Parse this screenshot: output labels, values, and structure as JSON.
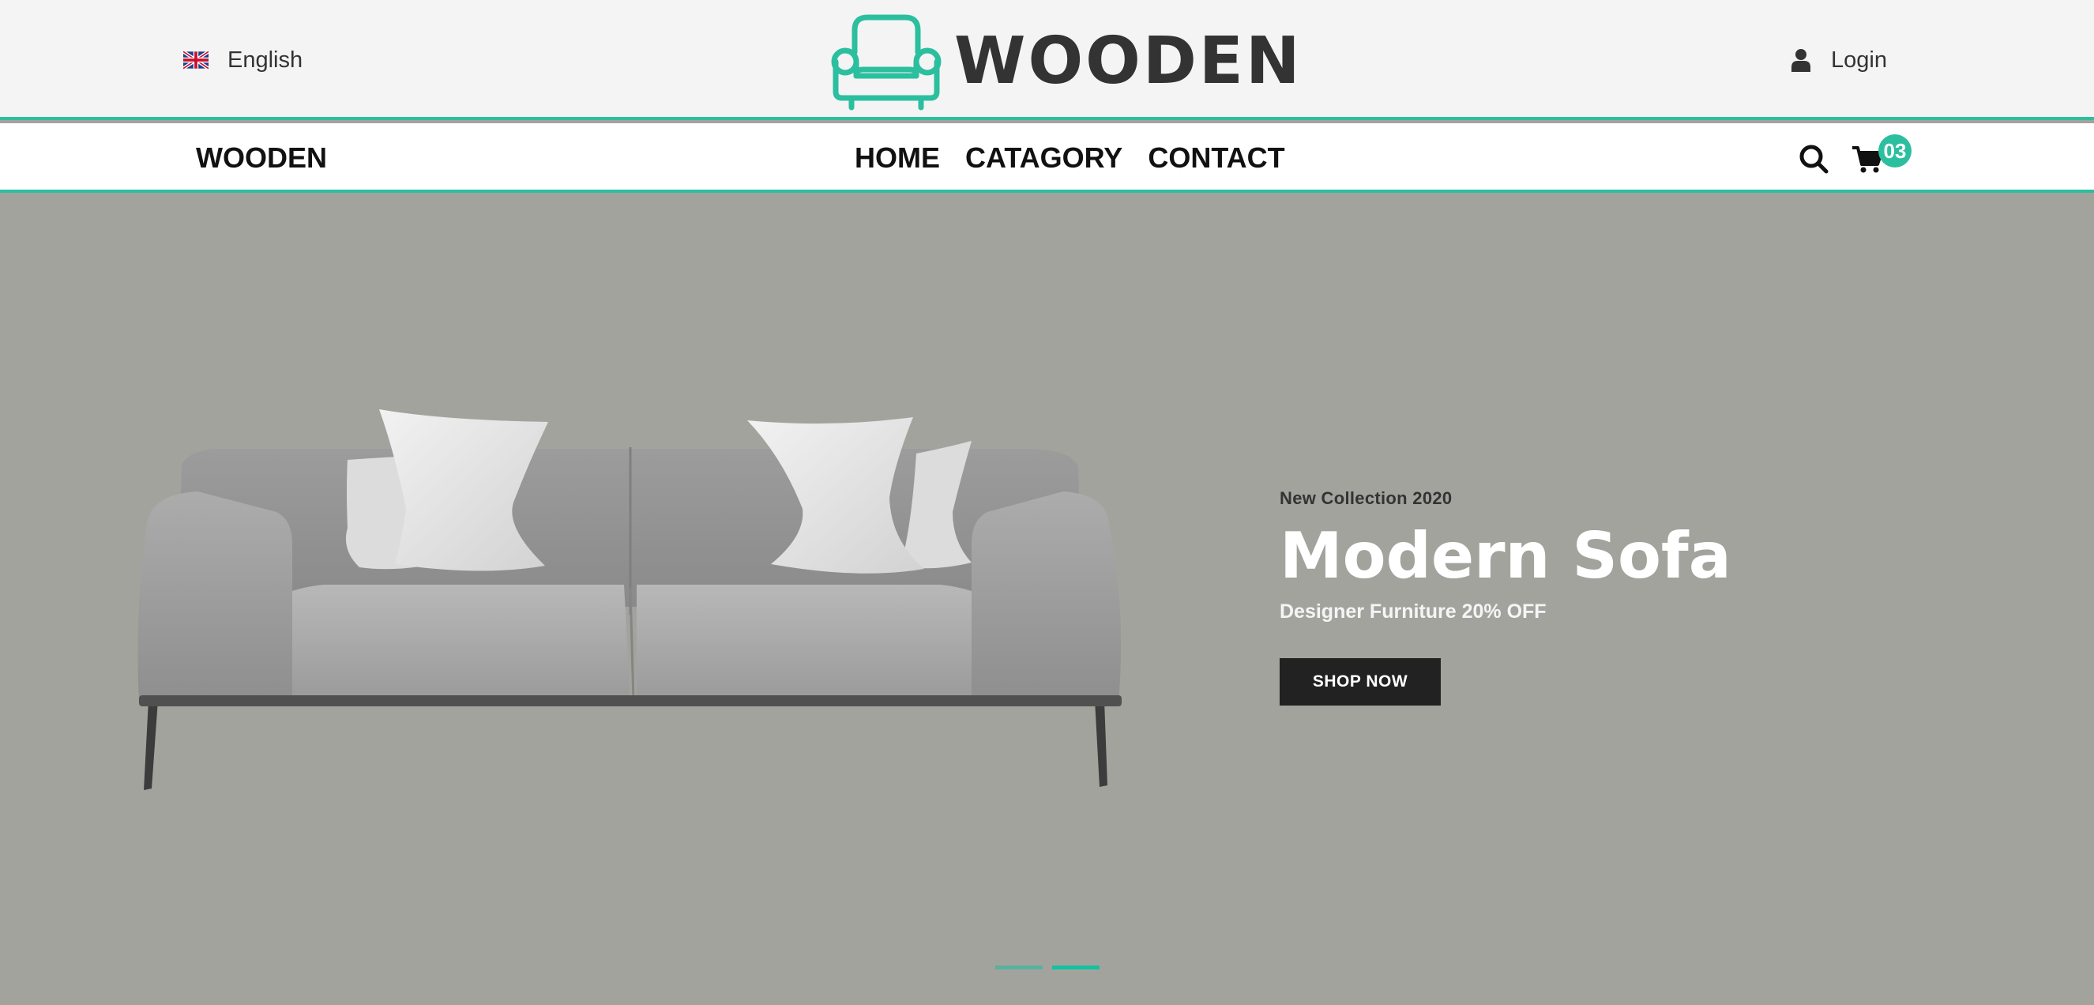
{
  "colors": {
    "accent": "#2bbf9f",
    "topbar_bg": "#f4f4f4",
    "hero_bg": "#a3a39e",
    "button_bg": "#222222"
  },
  "topbar": {
    "language": {
      "icon": "uk-flag-icon",
      "label": "English"
    },
    "logo": {
      "icon": "armchair-icon",
      "text": "WOODEN"
    },
    "login": {
      "icon": "user-icon",
      "label": "Login"
    }
  },
  "navbar": {
    "brand": "WOODEN",
    "menu": [
      {
        "label": "HOME"
      },
      {
        "label": "CATAGORY"
      },
      {
        "label": "CONTACT"
      }
    ],
    "search_icon": "search-icon",
    "cart": {
      "icon": "cart-icon",
      "count": "03"
    }
  },
  "hero": {
    "image": "grey-sofa-with-white-pillows",
    "kicker": "New Collection 2020",
    "title": "Modern Sofa",
    "subtitle": "Designer Furniture 20% OFF",
    "cta": "SHOP NOW",
    "slides": {
      "total": 2,
      "active": 2
    }
  }
}
